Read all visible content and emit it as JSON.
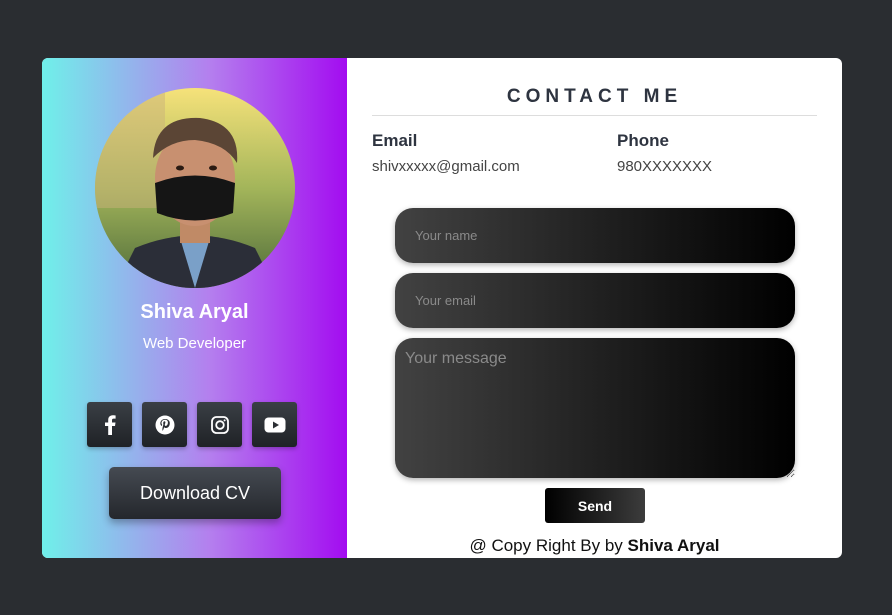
{
  "profile": {
    "name": "Shiva Aryal",
    "role": "Web Developer",
    "download_cv_label": "Download CV",
    "socials": [
      "facebook-icon",
      "pinterest-icon",
      "instagram-icon",
      "youtube-icon"
    ]
  },
  "contact": {
    "title": "CONTACT ME",
    "email_label": "Email",
    "email_value": "shivxxxxx@gmail.com",
    "phone_label": "Phone",
    "phone_value": "980XXXXXXX"
  },
  "form": {
    "name_placeholder": "Your name",
    "email_placeholder": "Your email",
    "message_placeholder": "Your message",
    "send_label": "Send"
  },
  "footer": {
    "copyright_prefix": "@ Copy Right By by",
    "copyright_name": "Shiva Aryal"
  },
  "colors": {
    "page_bg": "#2a2d31",
    "gradient_start": "#6ff0ea",
    "gradient_end": "#a30cf0"
  }
}
